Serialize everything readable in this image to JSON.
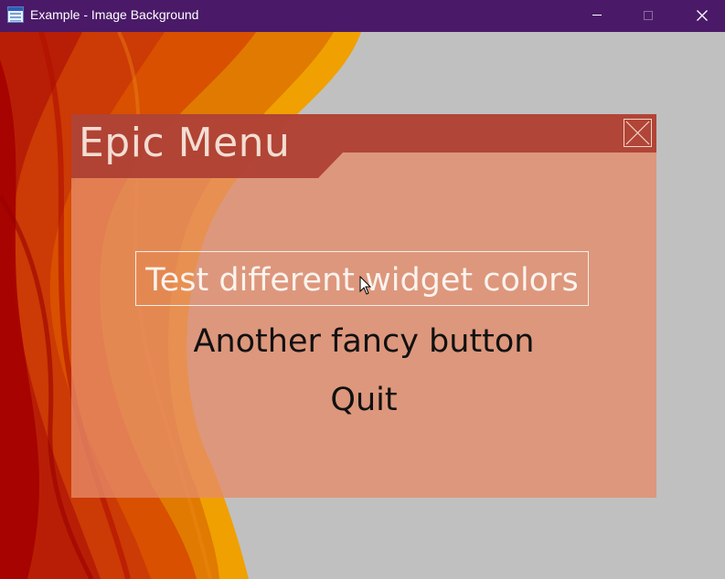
{
  "window": {
    "title": "Example - Image Background",
    "icon": "app-window-icon",
    "controls": [
      "minimize-icon",
      "maximize-icon",
      "close-icon"
    ],
    "titlebar_color": "#4a1a68"
  },
  "menu": {
    "title": "Epic Menu",
    "close_icon": "close-x-icon",
    "buttons": [
      {
        "label": "Test different widget colors",
        "state": "hovered"
      },
      {
        "label": "Another fancy button"
      },
      {
        "label": "Quit"
      }
    ],
    "header_color": "#ae4034",
    "panel_color": "#e68c69"
  },
  "background": {
    "colors": [
      "#a50000",
      "#d23c00",
      "#e07a00",
      "#f09800",
      "#c0c0c0"
    ]
  }
}
